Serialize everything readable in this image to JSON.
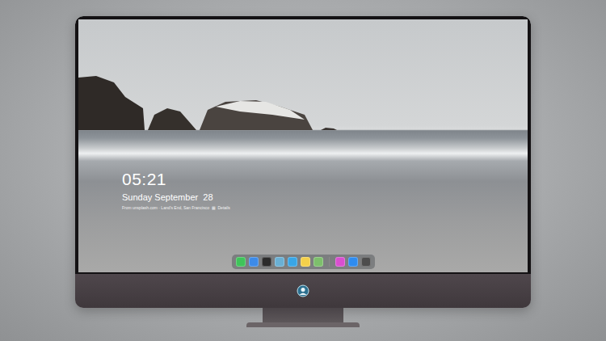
{
  "lock_screen": {
    "time": "05:21",
    "date": "Sunday September  28",
    "caption": "From unsplash.com · Land's End, San Francisco  ▦  Details"
  },
  "dock": {
    "items": [
      {
        "kind": "app",
        "color": "#3fc45a"
      },
      {
        "kind": "app",
        "color": "#3d8be8"
      },
      {
        "kind": "app",
        "color": "#2b2b2b"
      },
      {
        "kind": "app",
        "color": "#6ab0d4"
      },
      {
        "kind": "app",
        "color": "#39a6e6"
      },
      {
        "kind": "app",
        "color": "#f4d04a"
      },
      {
        "kind": "app",
        "color": "#7dbf6c"
      },
      {
        "kind": "separator",
        "color": "#8a8a8a"
      },
      {
        "kind": "app",
        "color": "#d94fd0"
      },
      {
        "kind": "app",
        "color": "#2f8cf0"
      },
      {
        "kind": "app",
        "color": "#4d4d4d"
      }
    ]
  }
}
